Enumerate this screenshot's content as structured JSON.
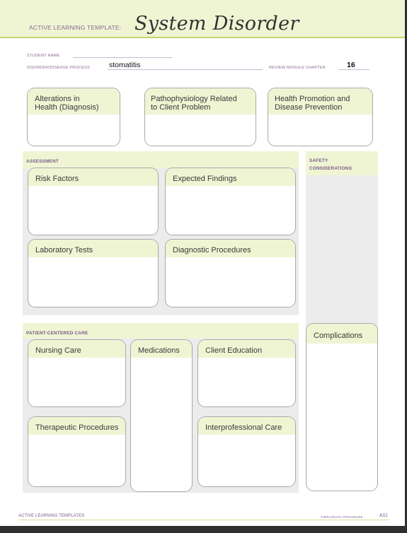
{
  "header": {
    "template_label": "ACTIVE LEARNING TEMPLATE:",
    "title": "System Disorder"
  },
  "fields": {
    "student_name": {
      "label": "STUDENT NAME",
      "value": ""
    },
    "disorder": {
      "label": "DISORDER/DISEASE PROCESS",
      "value": "stomatitis"
    },
    "chapter": {
      "label": "REVIEW MODULE CHAPTER",
      "value": "16"
    }
  },
  "top_boxes": [
    {
      "title_line1": "Alterations in",
      "title_line2": "Health (Diagnosis)"
    },
    {
      "title_line1": "Pathophysiology Related",
      "title_line2": "to Client Problem"
    },
    {
      "title_line1": "Health Promotion and",
      "title_line2": "Disease Prevention"
    }
  ],
  "assessment": {
    "title": "ASSESSMENT",
    "boxes": [
      "Risk Factors",
      "Expected Findings",
      "Laboratory Tests",
      "Diagnostic Procedures"
    ]
  },
  "safety": {
    "title_line1": "SAFETY",
    "title_line2": "CONSIDERATIONS"
  },
  "patient_care": {
    "title": "PATIENT-CENTERED CARE",
    "boxes": [
      "Nursing Care",
      "Medications",
      "Client Education",
      "Therapeutic Procedures",
      "Interprofessional Care"
    ]
  },
  "complications": {
    "title": "Complications"
  },
  "footer": {
    "left": "ACTIVE LEARNING TEMPLATES",
    "right": "THERAPEUTIC PROCEDURE",
    "page": "A11"
  },
  "colors": {
    "accent_green": "#eff5d3",
    "rule_green": "#c3d56a",
    "label_purple": "#7a5a88",
    "panel_gray": "#ececec"
  }
}
